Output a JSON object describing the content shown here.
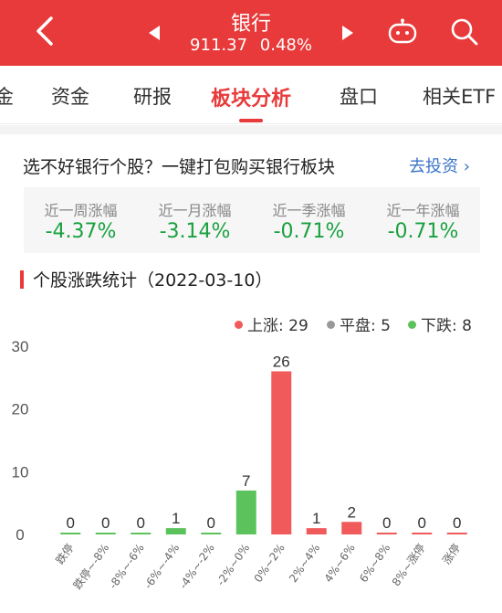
{
  "header": {
    "title": "银行",
    "index_value": "911.37",
    "change_pct": "0.48%"
  },
  "tabs": [
    {
      "label": "金",
      "active": false
    },
    {
      "label": "资金",
      "active": false
    },
    {
      "label": "研报",
      "active": false
    },
    {
      "label": "板块分析",
      "active": true
    },
    {
      "label": "盘口",
      "active": false
    },
    {
      "label": "相关ETF",
      "active": false
    }
  ],
  "promo": {
    "text": "选不好银行个股？一键打包购买银行板块",
    "link": "去投资 ›"
  },
  "stats": [
    {
      "label": "近一周涨幅",
      "value": "-4.37%"
    },
    {
      "label": "近一月涨幅",
      "value": "-3.14%"
    },
    {
      "label": "近一季涨幅",
      "value": "-0.71%"
    },
    {
      "label": "近一年涨幅",
      "value": "-0.71%"
    }
  ],
  "section_title": "个股涨跌统计（2022-03-10）",
  "legend": {
    "up": "上涨: 29",
    "flat": "平盘: 5",
    "down": "下跌: 8"
  },
  "colors": {
    "brand_red": "#e83a3a",
    "up": "#f05a5a",
    "flat": "#999999",
    "down": "#5cc35c",
    "stat_green": "#1aa140",
    "link_blue": "#3a73c8"
  },
  "chart_data": {
    "type": "bar",
    "categories": [
      "跌停",
      "跌停~-8%",
      "-8%~-6%",
      "-6%~-4%",
      "-4%~-2%",
      "-2%~0%",
      "0%~2%",
      "2%~4%",
      "4%~6%",
      "6%~8%",
      "8%~涨停",
      "涨停"
    ],
    "values": [
      0,
      0,
      0,
      1,
      0,
      7,
      26,
      1,
      2,
      0,
      0,
      0
    ],
    "bar_colors": [
      "down",
      "down",
      "down",
      "down",
      "down",
      "down",
      "up",
      "up",
      "up",
      "up",
      "up",
      "up"
    ],
    "yticks": [
      0,
      10,
      20,
      30
    ],
    "ylim": [
      0,
      30
    ],
    "grid": false,
    "legend_position": "top-right"
  }
}
